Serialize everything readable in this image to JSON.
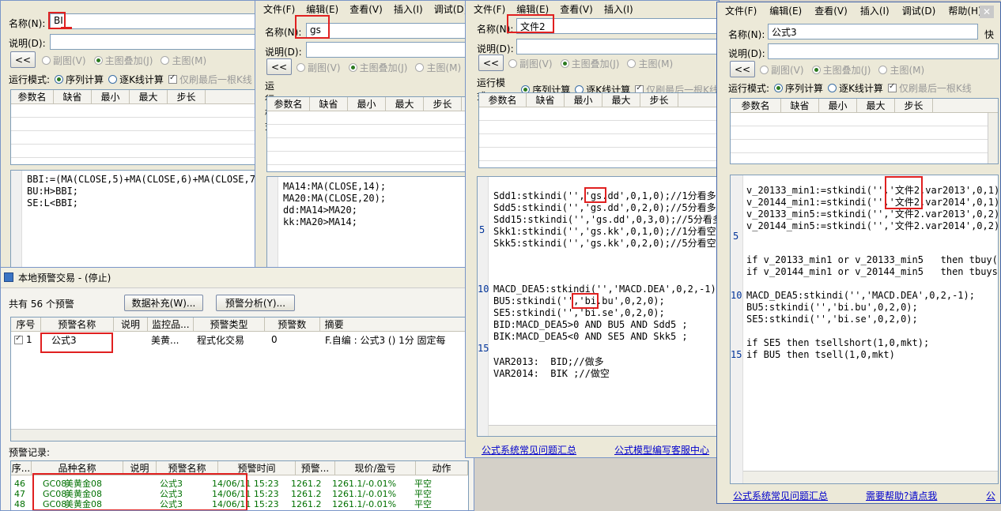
{
  "menu": {
    "file": "文件(F)",
    "edit": "编辑(E)",
    "view": "查看(V)",
    "insert": "插入(I)",
    "debug": "调试(D)",
    "help": "帮助(H)"
  },
  "labels": {
    "name": "名称(N):",
    "desc": "说明(D):",
    "run_mode": "运行模式:",
    "seq": "序列计算",
    "per_k": "逐K线计算",
    "refresh_last": "仅刷最后一根K线",
    "sub_chart": "副图(V)",
    "overlay": "主图叠加(J)",
    "main_chart": "主图(M)",
    "back_btn": "<<"
  },
  "param_headers": [
    "参数名",
    "缺省",
    "最小",
    "最大",
    "步长"
  ],
  "win_bi": {
    "name": "BI",
    "code": [
      "BBI:=(MA(CLOSE,5)+MA(CLOSE,6)+MA(CLOSE,7)",
      "BU:H>BBI;",
      "SE:L<BBI;"
    ]
  },
  "win_gs": {
    "name": "gs",
    "code": [
      "MA14:MA(CLOSE,14);",
      "MA20:MA(CLOSE,20);",
      "dd:MA14>MA20;",
      "kk:MA20>MA14;"
    ]
  },
  "win_f2": {
    "name": "文件2",
    "code": [
      "Sdd1:stkindi('','gs.dd',0,1,0);//1分看多",
      "Sdd5:stkindi('','gs.dd',0,2,0);//5分看多",
      "Sdd15:stkindi('','gs.dd',0,3,0);//5分看多",
      "Skk1:stkindi('','gs.kk',0,1,0);//1分看空",
      "Skk5:stkindi('','gs.kk',0,2,0);//5分看空",
      "",
      "MACD_DEA5:stkindi('','MACD.DEA',0,2,-1);",
      "BU5:stkindi('','bi.bu',0,2,0);",
      "SE5:stkindi('','bi.se',0,2,0);",
      "BID:MACD_DEA5>0 AND BU5 AND Sdd5 ;",
      "BIK:MACD_DEA5<0 AND SE5 AND Skk5 ;",
      "VAR2013:  BID;//做多",
      "VAR2014:  BIK ;//做空"
    ],
    "line_numbers": [
      "5",
      "10",
      "15"
    ],
    "link1": "公式系统常见问题汇总",
    "link2": "公式模型编写客服中心"
  },
  "win_f3": {
    "name": "公式3",
    "quick": "快",
    "code": [
      "v_20133_min1:=stkindi('','文件2.var2013',0,1)",
      "v_20144_min1:=stkindi('','文件2.var2014',0,1)",
      "v_20133_min5:=stkindi('','文件2.var2013',0,2)",
      "v_20144_min5:=stkindi('','文件2.var2014',0,2)",
      "if v_20133_min1 or v_20133_min5   then tbuy(th",
      "if v_20144_min1 or v_20144_min5   then tbuysh",
      "MACD_DEA5:stkindi('','MACD.DEA',0,2,-1);",
      "BU5:stkindi('','bi.bu',0,2,0);",
      "SE5:stkindi('','bi.se',0,2,0);",
      "if SE5 then tsellshort(1,0,mkt);",
      "if BU5 then tsell(1,0,mkt)"
    ],
    "line_numbers": [
      "5",
      "10",
      "15"
    ],
    "link1": "公式系统常见问题汇总",
    "link2": "需要帮助?请点我",
    "link3": "公"
  },
  "alert": {
    "title": "本地预警交易 - (停止)",
    "count": "共有 56 个预警",
    "btn_data": "数据补充(W)...",
    "btn_analysis": "预警分析(Y)...",
    "headers": [
      "序号",
      "预警名称",
      "说明",
      "监控品...",
      "预警类型",
      "预警数",
      "摘要"
    ],
    "row": {
      "no": "1",
      "name": "公式3",
      "desc": "",
      "target": "美黄...",
      "type": "程式化交易",
      "count": "0",
      "summary": "F.自编 : 公式3 () 1分 固定每"
    },
    "log_label": "预警记录:",
    "log_headers": [
      "序...",
      "品种名称",
      "说明",
      "预警名称",
      "预警时间",
      "预警...",
      "现价/盈亏",
      "动作"
    ],
    "log_rows": [
      {
        "no": "46",
        "code": "GC08",
        "name": "美黄金08",
        "alert": "公式3",
        "time": "14/06/11 15:23",
        "price": "1261.2",
        "pnl": "1261.1/-0.01%",
        "action": "平空"
      },
      {
        "no": "47",
        "code": "GC08",
        "name": "美黄金08",
        "alert": "公式3",
        "time": "14/06/11 15:23",
        "price": "1261.2",
        "pnl": "1261.1/-0.01%",
        "action": "平空"
      },
      {
        "no": "48",
        "code": "GC08",
        "name": "美黄金08",
        "alert": "公式3",
        "time": "14/06/11 15:23",
        "price": "1261.2",
        "pnl": "1261.1/-0.01%",
        "action": "平空"
      }
    ]
  },
  "colors": {
    "highlight": "#e02020",
    "keyword": "#0000c0",
    "string": "#990000",
    "comment": "#008000"
  }
}
